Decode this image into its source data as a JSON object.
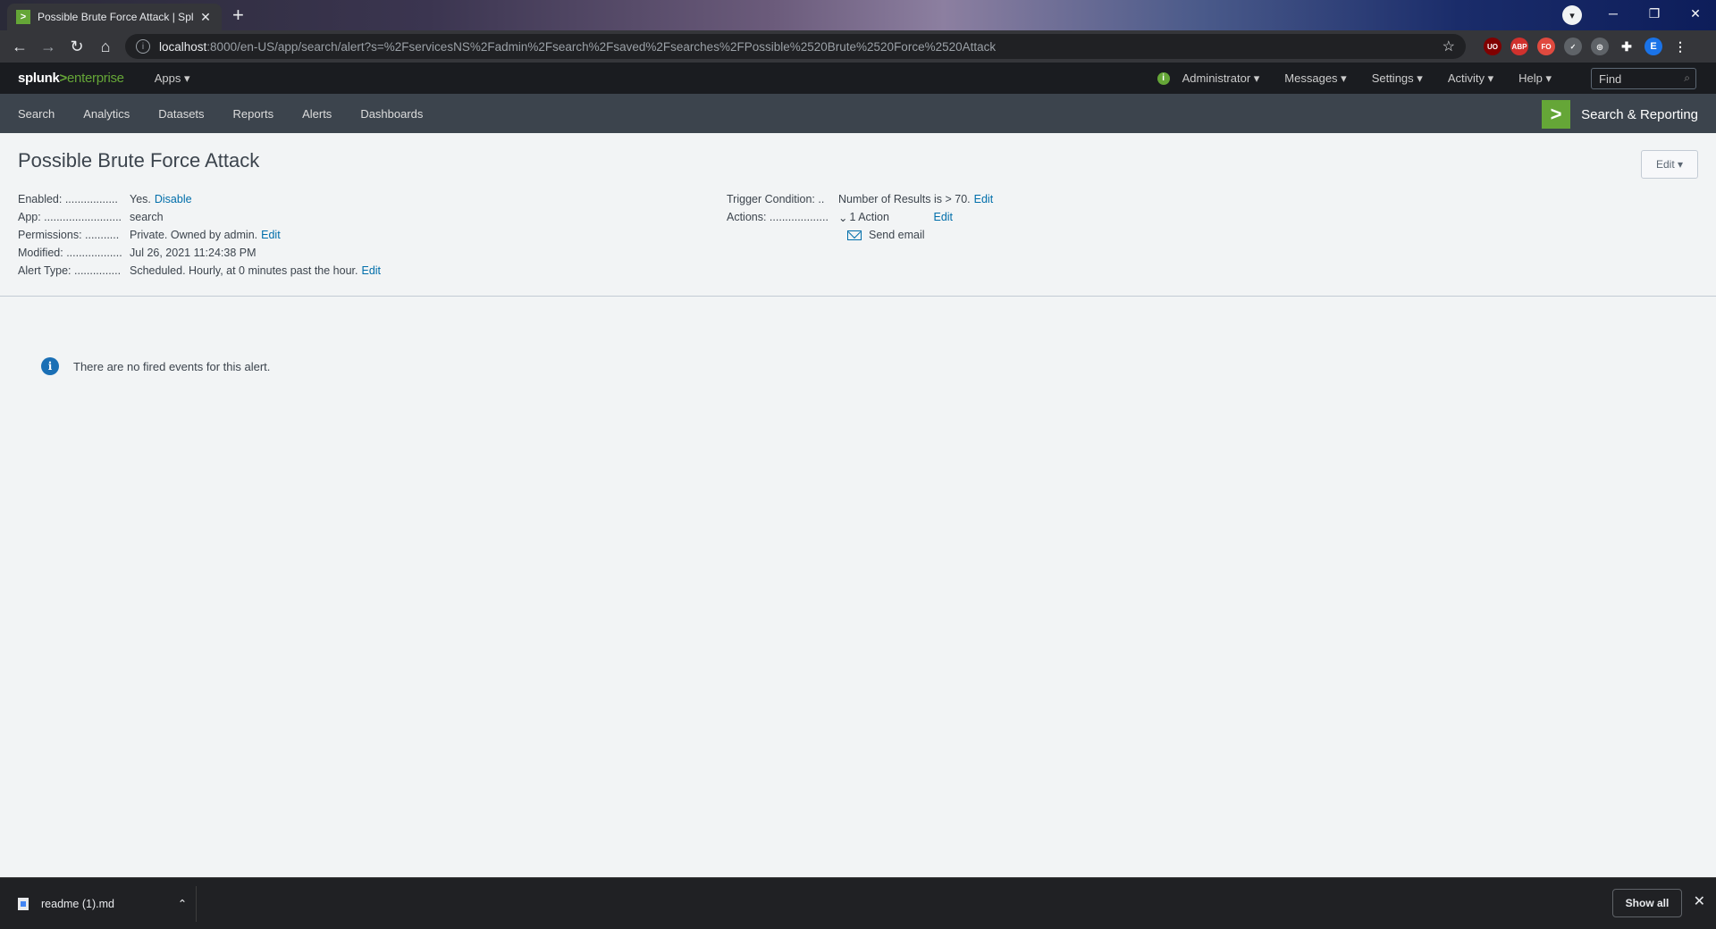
{
  "browser": {
    "tab_title": "Possible Brute Force Attack | Splu",
    "tab_favicon": ">",
    "url_host": "localhost",
    "url_path": ":8000/en-US/app/search/alert?s=%2FservicesNS%2Fadmin%2Fsearch%2Fsaved%2Fsearches%2FPossible%2520Brute%2520Force%2520Attack",
    "profile_initial": "E",
    "extensions": [
      "UO",
      "ABP",
      "FO"
    ]
  },
  "splunk": {
    "logo_main": "splunk",
    "logo_gt": ">",
    "logo_sub": "enterprise",
    "apps_label": "Apps ▾",
    "menus": [
      "Administrator ▾",
      "Messages ▾",
      "Settings ▾",
      "Activity ▾",
      "Help ▾"
    ],
    "find_placeholder": "Find"
  },
  "app_bar": {
    "nav": [
      "Search",
      "Analytics",
      "Datasets",
      "Reports",
      "Alerts",
      "Dashboards"
    ],
    "app_name": "Search & Reporting"
  },
  "alert": {
    "title": "Possible Brute Force Attack",
    "edit_button": "Edit ▾",
    "enabled_label": "Enabled: .................",
    "enabled_value": "Yes.",
    "enabled_link": "Disable",
    "app_label": "App: .........................",
    "app_value": "search",
    "permissions_label": "Permissions: ...........",
    "permissions_value": "Private. Owned by admin.",
    "permissions_link": "Edit",
    "modified_label": "Modified: ..................",
    "modified_value": "Jul 26, 2021 11:24:38 PM",
    "alert_type_label": "Alert Type: ...............",
    "alert_type_value": "Scheduled. Hourly, at 0 minutes past the hour.",
    "alert_type_link": "Edit",
    "trigger_label": "Trigger Condition: ..",
    "trigger_value": "Number of Results is > 70.",
    "trigger_link": "Edit",
    "actions_label": "Actions: ...................",
    "actions_value": "1 Action",
    "actions_link": "Edit",
    "action_item": "Send email",
    "notice": "There are no fired events for this alert."
  },
  "downloads": {
    "file_name": "readme (1).md",
    "show_all": "Show all"
  }
}
